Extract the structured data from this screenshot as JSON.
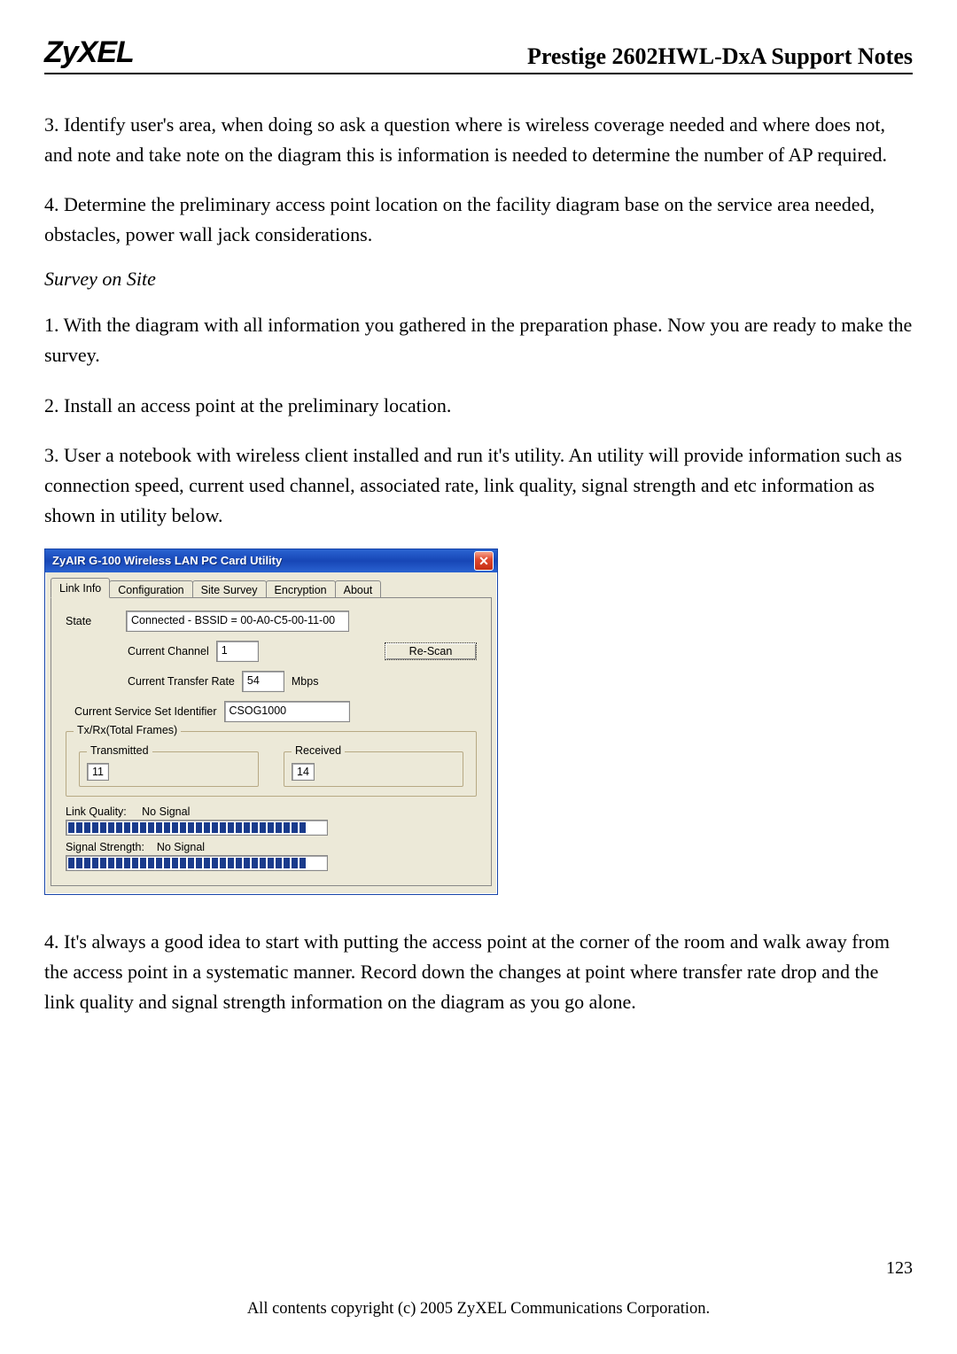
{
  "header": {
    "logo_text": "ZyXEL",
    "title": "Prestige 2602HWL-DxA Support Notes"
  },
  "body": {
    "p3": "3. Identify user's area, when doing so ask a question where is wireless coverage needed and where does not, and note and take note on the diagram this is information is needed to determine the number of AP required.",
    "p4": "4. Determine the preliminary access point location on the facility diagram base on the service area needed, obstacles, power wall jack considerations.",
    "survey_heading": "Survey on Site",
    "s1": "1. With the diagram with all information you gathered in the preparation phase.  Now you are ready to make the survey.",
    "s2": "2. Install an access point at the preliminary location.",
    "s3": "3. User a notebook with wireless client installed and run it's utility. An utility will provide information such as connection speed, current used channel, associated rate, link quality, signal strength and etc information as shown in utility below.",
    "s4": "4. It's always a good idea to start with putting the access point at the corner of the room and walk away from the access point in a systematic manner. Record down the changes at point where transfer rate drop and the link quality and signal strength information on the diagram as you go alone."
  },
  "dialog": {
    "title": "ZyAIR G-100  Wireless LAN PC Card Utility",
    "tabs": {
      "link_info": "Link Info",
      "configuration": "Configuration",
      "site_survey": "Site Survey",
      "encryption": "Encryption",
      "about": "About"
    },
    "labels": {
      "state": "State",
      "current_channel": "Current Channel",
      "current_rate": "Current Transfer Rate",
      "mbps": "Mbps",
      "ssid": "Current Service Set Identifier",
      "txrx_group": "Tx/Rx(Total Frames)",
      "transmitted": "Transmitted",
      "received": "Received",
      "link_quality": "Link Quality:",
      "signal_strength": "Signal Strength:",
      "no_signal": "No Signal",
      "rescan": "Re-Scan"
    },
    "values": {
      "state": "Connected - BSSID = 00-A0-C5-00-11-00",
      "channel": "1",
      "rate": "54",
      "ssid": "CSOG1000",
      "tx": "11",
      "rx": "14"
    }
  },
  "footer": {
    "copyright": "All contents copyright (c) 2005 ZyXEL Communications Corporation.",
    "page_no": "123"
  }
}
